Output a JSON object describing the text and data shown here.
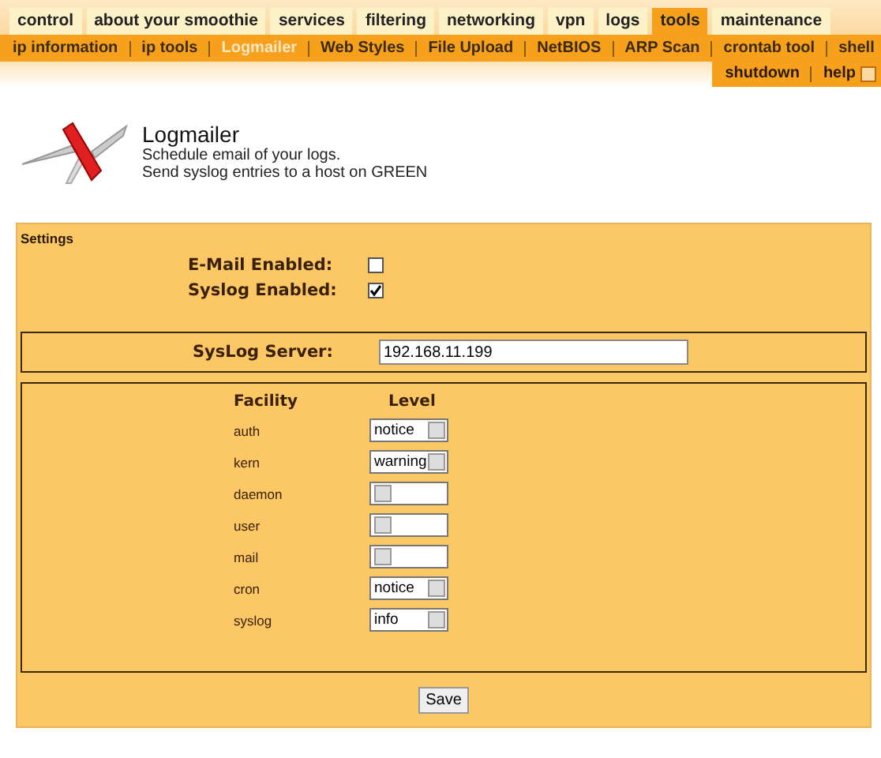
{
  "tabs": [
    {
      "label": "control",
      "selected": false
    },
    {
      "label": "about your smoothie",
      "selected": false
    },
    {
      "label": "services",
      "selected": false
    },
    {
      "label": "filtering",
      "selected": false
    },
    {
      "label": "networking",
      "selected": false
    },
    {
      "label": "vpn",
      "selected": false
    },
    {
      "label": "logs",
      "selected": false
    },
    {
      "label": "tools",
      "selected": true
    },
    {
      "label": "maintenance",
      "selected": false
    }
  ],
  "subnav": [
    {
      "label": "ip information",
      "selected": false
    },
    {
      "label": "ip tools",
      "selected": false
    },
    {
      "label": "Logmailer",
      "selected": true
    },
    {
      "label": "Web Styles",
      "selected": false
    },
    {
      "label": "File Upload",
      "selected": false
    },
    {
      "label": "NetBIOS",
      "selected": false
    },
    {
      "label": "ARP Scan",
      "selected": false
    },
    {
      "label": "crontab tool",
      "selected": false
    },
    {
      "label": "shell",
      "selected": false
    }
  ],
  "utility_links": [
    "shutdown",
    "help"
  ],
  "header": {
    "title": "Logmailer",
    "lines": [
      "Schedule email of your logs.",
      "Send syslog entries to a host on GREEN"
    ]
  },
  "settings": {
    "title": "Settings",
    "options": [
      {
        "label": "E-Mail Enabled:",
        "checked": false
      },
      {
        "label": "Syslog Enabled:",
        "checked": true
      }
    ],
    "server": {
      "label": "SysLog Server:",
      "value": "192.168.11.199"
    },
    "columns": [
      "Facility",
      "Level"
    ],
    "facilities": [
      {
        "name": "auth",
        "value": "notice"
      },
      {
        "name": "kern",
        "value": "warning"
      },
      {
        "name": "daemon"
      },
      {
        "name": "user"
      },
      {
        "name": "mail"
      },
      {
        "name": "cron",
        "value": "notice"
      },
      {
        "name": "syslog",
        "value": "info"
      }
    ],
    "save_button": "Save"
  }
}
